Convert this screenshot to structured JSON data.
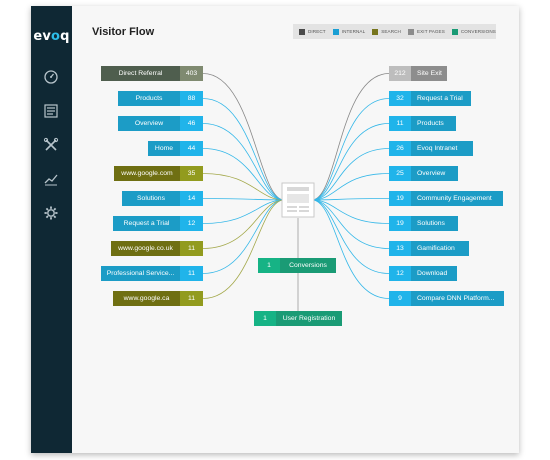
{
  "app": {
    "logo_prefix": "ev",
    "logo_accent": "o",
    "logo_suffix": "q"
  },
  "sidebar": {
    "items": [
      {
        "icon": "dashboard-gauge-icon"
      },
      {
        "icon": "content-list-icon"
      },
      {
        "icon": "tools-icon"
      },
      {
        "icon": "analytics-trend-icon"
      },
      {
        "icon": "settings-gear-icon"
      }
    ]
  },
  "page": {
    "title": "Visitor Flow"
  },
  "legend": [
    {
      "label": "DIRECT",
      "color": "#4a4a4a"
    },
    {
      "label": "INTERNAL",
      "color": "#1a9fd4"
    },
    {
      "label": "SEARCH",
      "color": "#77751d"
    },
    {
      "label": "EXIT PAGES",
      "color": "#8c8c8c"
    },
    {
      "label": "CONVERSIONS",
      "color": "#1a9b75"
    }
  ],
  "colors": {
    "direct_label": "#4f5e4e",
    "direct_count": "#7f8a70",
    "internal_label": "#1c9cc6",
    "internal_count": "#20b4ea",
    "search_label": "#6f6f12",
    "search_count": "#929b1e",
    "exit_label": "#8d8d8d",
    "exit_count": "#bdbdbd",
    "conv_label": "#1a9b75",
    "conv_count": "#16b385",
    "line_internal": "#33b7e8",
    "line_direct": "#888888",
    "line_search": "#a3a84a"
  },
  "sources": [
    {
      "label": "Direct Referral",
      "count": "403",
      "type": "direct"
    },
    {
      "label": "Products",
      "count": "88",
      "type": "internal"
    },
    {
      "label": "Overview",
      "count": "46",
      "type": "internal"
    },
    {
      "label": "Home",
      "count": "44",
      "type": "internal"
    },
    {
      "label": "www.google.com",
      "count": "35",
      "type": "search"
    },
    {
      "label": "Solutions",
      "count": "14",
      "type": "internal"
    },
    {
      "label": "Request a Trial",
      "count": "12",
      "type": "internal"
    },
    {
      "label": "www.google.co.uk",
      "count": "11",
      "type": "search"
    },
    {
      "label": "Professional Service...",
      "count": "11",
      "type": "internal"
    },
    {
      "label": "www.google.ca",
      "count": "11",
      "type": "search"
    }
  ],
  "destinations": [
    {
      "label": "Site Exit",
      "count": "212",
      "type": "exit"
    },
    {
      "label": "Request a Trial",
      "count": "32",
      "type": "internal"
    },
    {
      "label": "Products",
      "count": "11",
      "type": "internal"
    },
    {
      "label": "Evoq Intranet",
      "count": "26",
      "type": "internal"
    },
    {
      "label": "Overview",
      "count": "25",
      "type": "internal"
    },
    {
      "label": "Community Engagement",
      "count": "19",
      "type": "internal"
    },
    {
      "label": "Solutions",
      "count": "19",
      "type": "internal"
    },
    {
      "label": "Gamification",
      "count": "13",
      "type": "internal"
    },
    {
      "label": "Download",
      "count": "12",
      "type": "internal"
    },
    {
      "label": "Compare DNN Platform...",
      "count": "9",
      "type": "internal"
    }
  ],
  "conversions": [
    {
      "label": "Conversions",
      "count": "1"
    },
    {
      "label": "User Registration",
      "count": "1"
    }
  ]
}
